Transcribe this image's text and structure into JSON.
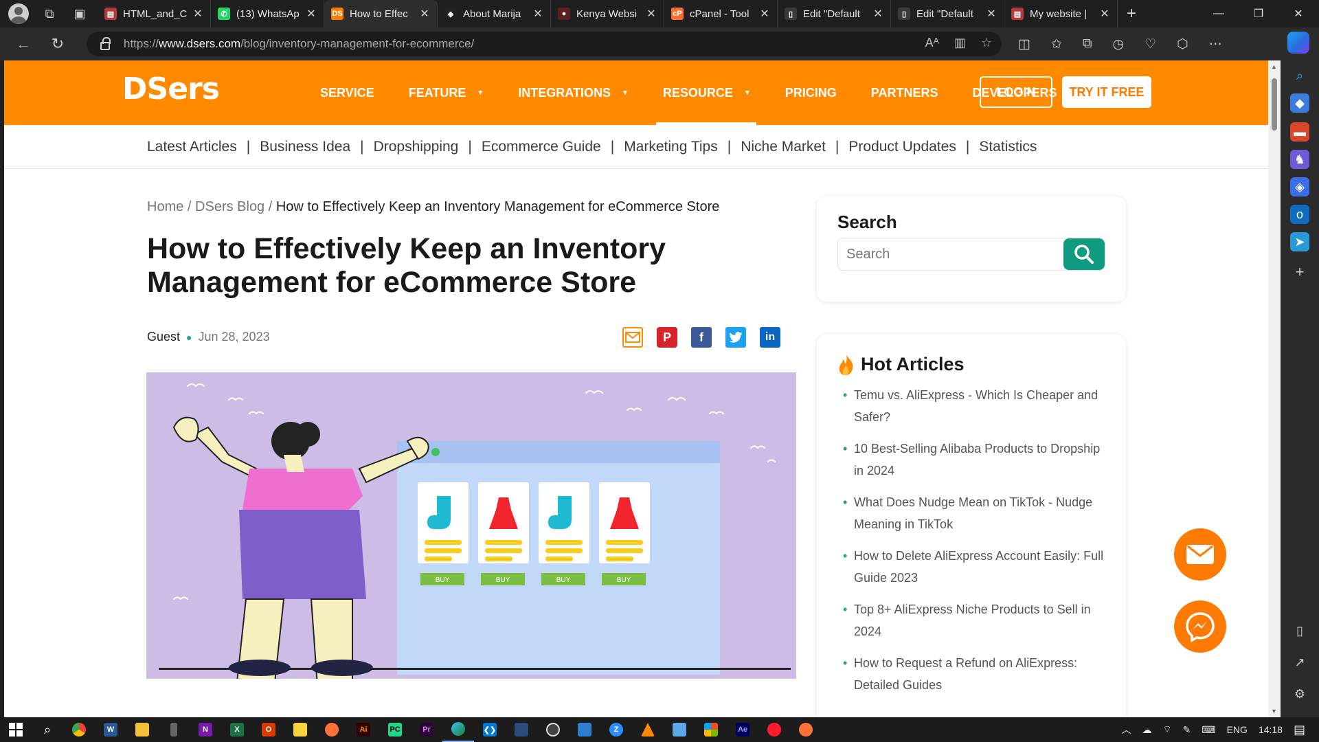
{
  "browser": {
    "tabs": [
      {
        "label": "HTML_and_C",
        "color": "#b23b3b",
        "glyph": "▤",
        "active": false
      },
      {
        "label": "(13) WhatsAp",
        "color": "#25d366",
        "glyph": "✆",
        "active": false
      },
      {
        "label": "How to Effec",
        "color": "#ff7a00",
        "glyph": "DS",
        "active": true
      },
      {
        "label": "About Marija",
        "color": "#222222",
        "glyph": "◆",
        "active": false
      },
      {
        "label": "Kenya Websi",
        "color": "#5a1f1f",
        "glyph": "●",
        "active": false
      },
      {
        "label": "cPanel - Tool",
        "color": "#ff6c2c",
        "glyph": "cP",
        "active": false
      },
      {
        "label": "Edit \"Default",
        "color": "#3a3a3a",
        "glyph": "▯",
        "active": false
      },
      {
        "label": "Edit \"Default",
        "color": "#3a3a3a",
        "glyph": "▯",
        "active": false
      },
      {
        "label": "My website |",
        "color": "#b23b3b",
        "glyph": "▤",
        "active": false
      }
    ],
    "url_prefix": "https://",
    "url_host": "www.dsers.com",
    "url_path": "/blog/inventory-management-for-ecommerce/"
  },
  "site": {
    "logo": "DSers",
    "nav": [
      {
        "label": "SERVICE",
        "caret": false
      },
      {
        "label": "FEATURE",
        "caret": true
      },
      {
        "label": "INTEGRATIONS",
        "caret": true
      },
      {
        "label": "RESOURCE",
        "caret": true
      },
      {
        "label": "PRICING",
        "caret": false
      },
      {
        "label": "PARTNERS",
        "caret": false
      },
      {
        "label": "DEVELOPERS",
        "caret": false
      }
    ],
    "login": "LOGIN",
    "try_free": "TRY IT FREE",
    "categories": [
      "Latest Articles",
      "Business Idea",
      "Dropshipping",
      "Ecommerce Guide",
      "Marketing Tips",
      "Niche Market",
      "Product Updates",
      "Statistics"
    ]
  },
  "article": {
    "breadcrumb": {
      "home": "Home",
      "blog": "DSers Blog",
      "current": "How to Effectively Keep an Inventory Management for eCommerce Store"
    },
    "title": "How to Effectively Keep an Inventory Management for eCommerce Store",
    "author": "Guest",
    "date": "Jun 28, 2023",
    "hero_buy": "BUY"
  },
  "sidebar": {
    "search_title": "Search",
    "search_placeholder": "Search",
    "hot_title": "Hot Articles",
    "hot_articles": [
      "Temu vs. AliExpress - Which Is Cheaper and Safer?",
      "10 Best-Selling Alibaba Products to Dropship in 2024",
      "What Does Nudge Mean on TikTok - Nudge Meaning in TikTok",
      "How to Delete AliExpress Account Easily: Full Guide 2023",
      "Top 8+ AliExpress Niche Products to Sell in 2024",
      "How to Request a Refund on AliExpress: Detailed Guides"
    ]
  },
  "taskbar": {
    "language": "ENG",
    "time": "14:18"
  }
}
